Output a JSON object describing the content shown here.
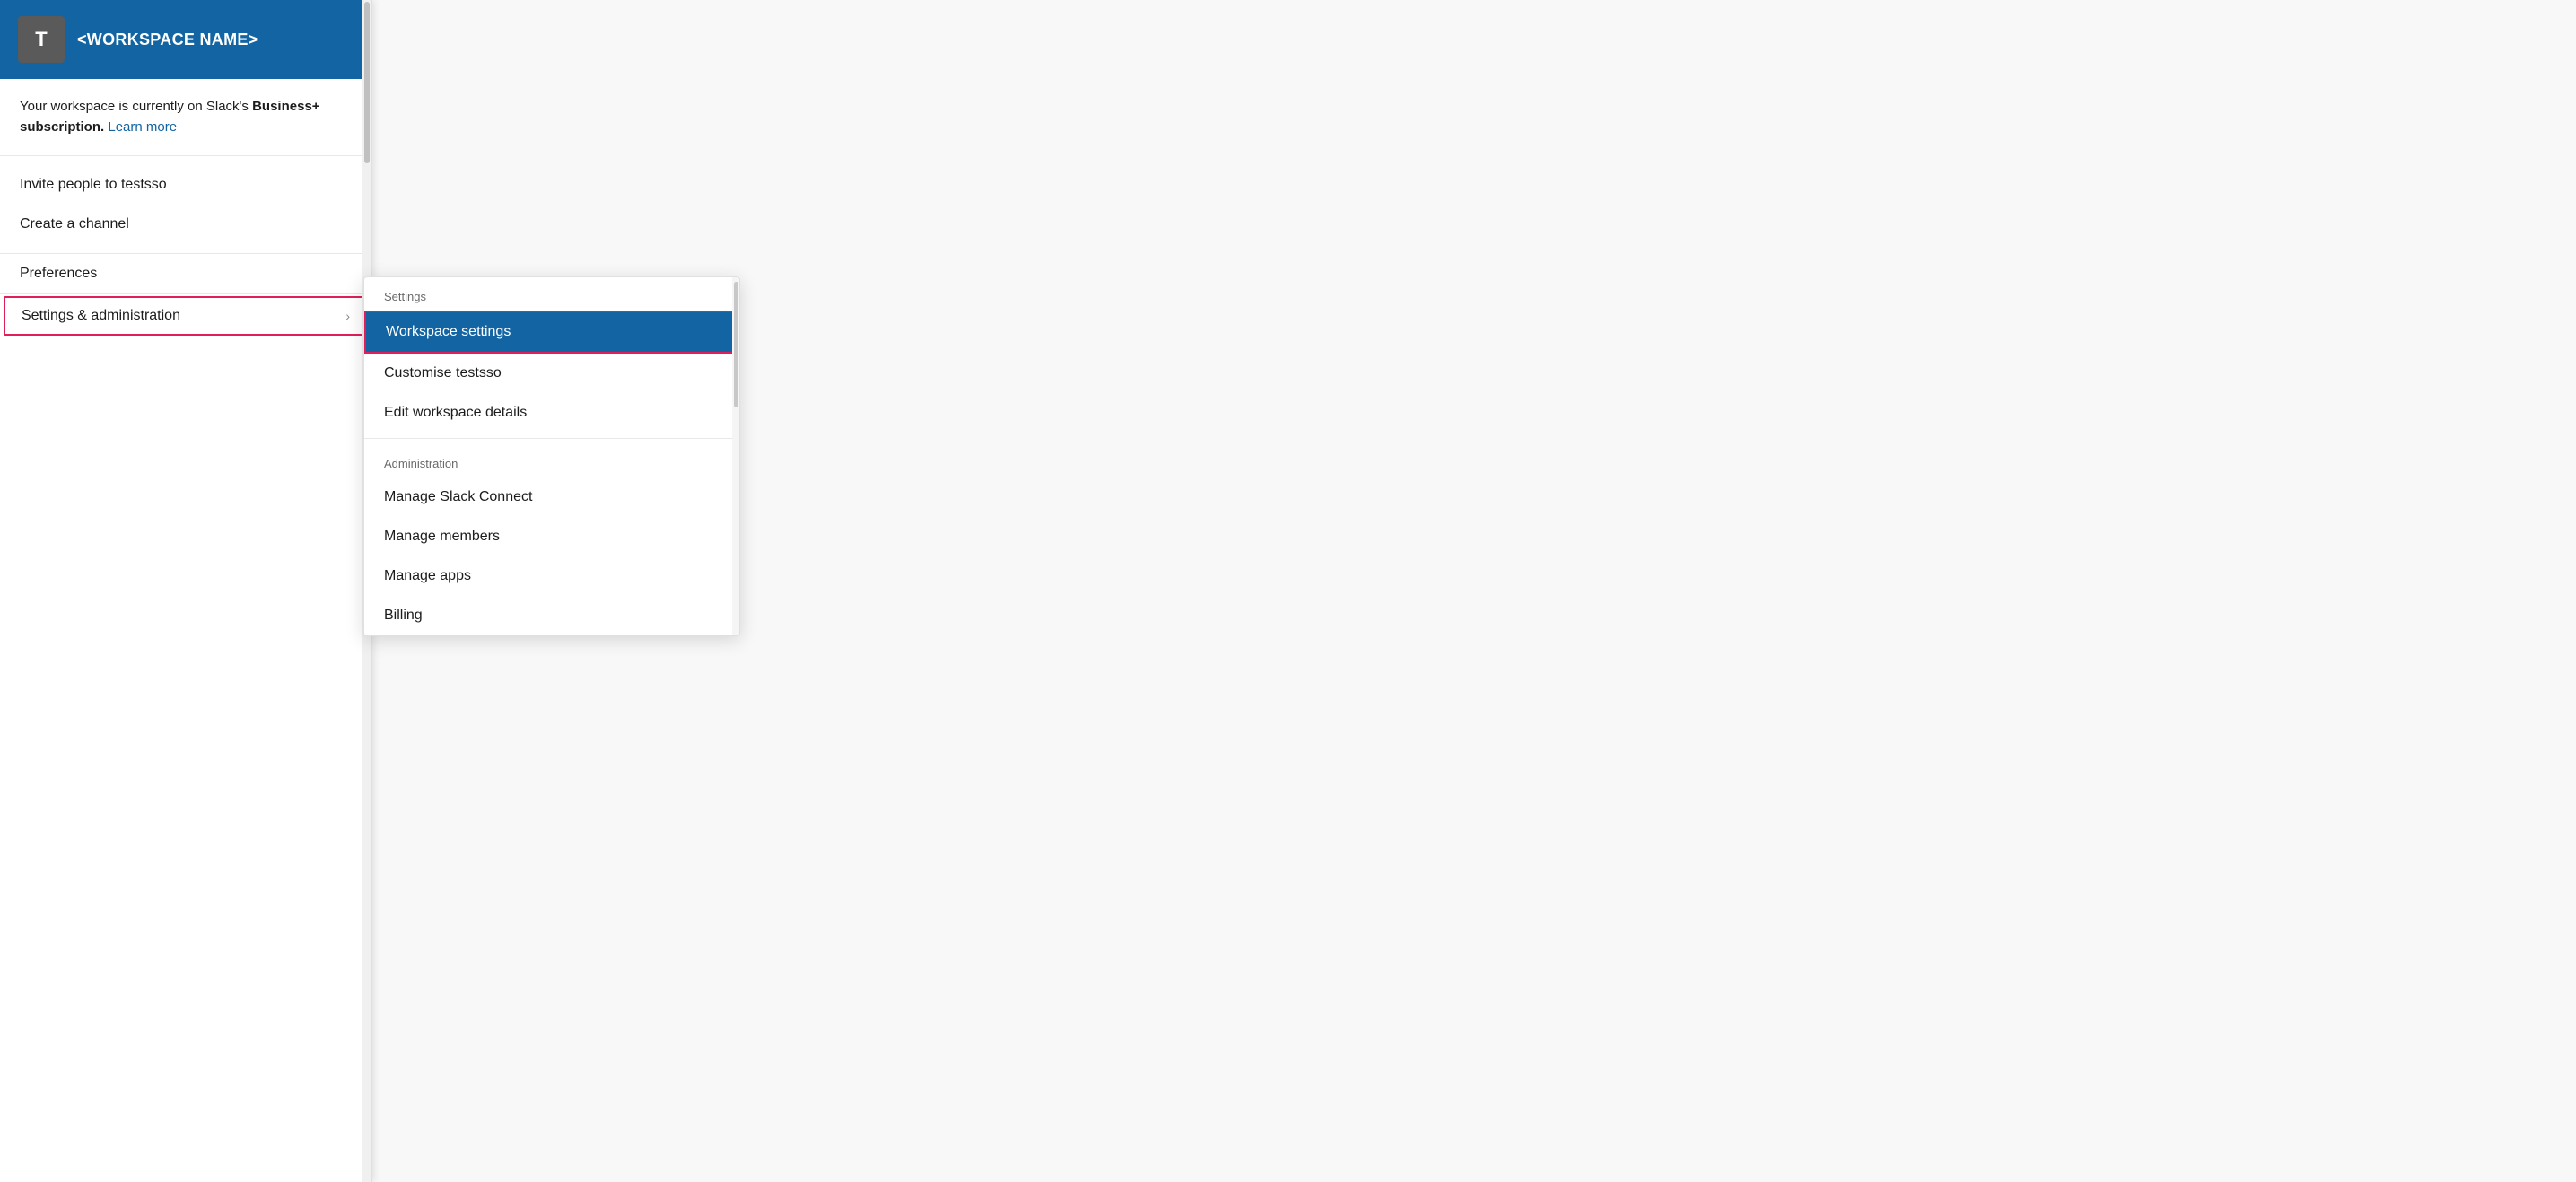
{
  "workspace": {
    "avatar_letter": "T",
    "name": "<WORKSPACE NAME>"
  },
  "subscription": {
    "text_before": "Your workspace is currently on Slack's ",
    "bold_text": "Business+ subscription.",
    "learn_more_label": "Learn more"
  },
  "menu": {
    "invite_label": "Invite people to testsso",
    "create_channel_label": "Create a channel",
    "preferences_label": "Preferences",
    "settings_admin_label": "Settings & administration"
  },
  "submenu": {
    "settings_section_label": "Settings",
    "workspace_settings_label": "Workspace settings",
    "customise_label": "Customise testsso",
    "edit_workspace_label": "Edit workspace details",
    "administration_section_label": "Administration",
    "manage_slack_connect_label": "Manage Slack Connect",
    "manage_members_label": "Manage members",
    "manage_apps_label": "Manage apps",
    "billing_label": "Billing"
  },
  "colors": {
    "header_bg": "#1264a3",
    "active_item_bg": "#1264a3",
    "highlight_border": "#e01e5a",
    "learn_more": "#1264a3"
  }
}
